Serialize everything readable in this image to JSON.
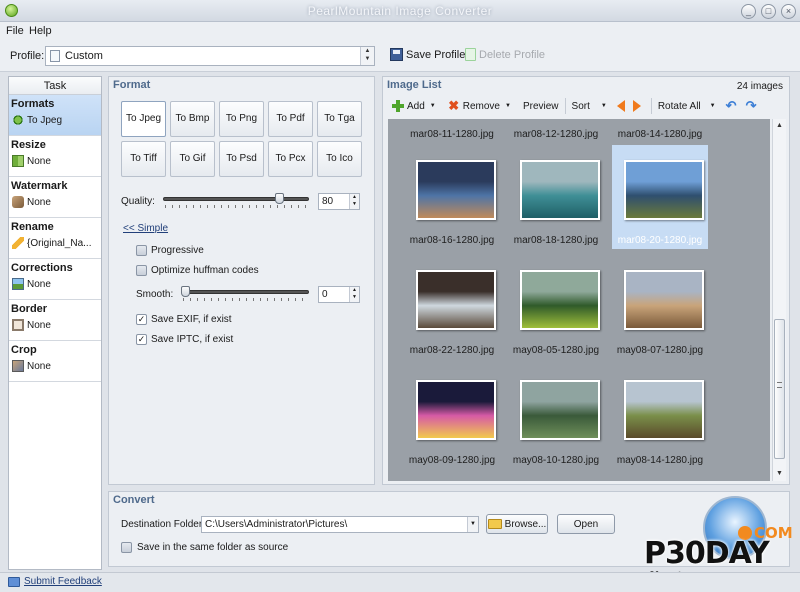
{
  "window": {
    "title": "PearlMountain Image Converter",
    "controls": [
      "_",
      "□",
      "×"
    ]
  },
  "menu": {
    "items": [
      "File",
      "Help"
    ]
  },
  "profile": {
    "label": "Profile:",
    "value": "Custom",
    "save_label": "Save Profile",
    "delete_label": "Delete Profile"
  },
  "task": {
    "header": "Task",
    "sections": [
      {
        "title": "Formats",
        "value": "To Jpeg",
        "icon": "convert-icon"
      },
      {
        "title": "Resize",
        "value": "None",
        "icon": "resize-icon"
      },
      {
        "title": "Watermark",
        "value": "None",
        "icon": "watermark-icon"
      },
      {
        "title": "Rename",
        "value": "{Original_Na...",
        "icon": "pencil-icon"
      },
      {
        "title": "Corrections",
        "value": "None",
        "icon": "corrections-icon"
      },
      {
        "title": "Border",
        "value": "None",
        "icon": "border-icon"
      },
      {
        "title": "Crop",
        "value": "None",
        "icon": "crop-icon"
      }
    ]
  },
  "format": {
    "title": "Format",
    "buttons": [
      "To Jpeg",
      "To Bmp",
      "To Png",
      "To Pdf",
      "To Tga",
      "To Tiff",
      "To Gif",
      "To Psd",
      "To Pcx",
      "To Ico"
    ],
    "quality_label": "Quality:",
    "quality_value": "80",
    "quality_level": 0.8,
    "simple_link": "<< Simple",
    "progressive_label": "Progressive",
    "huffman_label": "Optimize huffman codes",
    "smooth_label": "Smooth:",
    "smooth_value": "0",
    "smooth_level": 0,
    "exif_label": "Save EXIF, if exist",
    "iptc_label": "Save IPTC, if exist"
  },
  "imagelist": {
    "title": "Image List",
    "count": "24 images",
    "toolbar": {
      "add": "Add",
      "remove": "Remove",
      "preview": "Preview",
      "sort": "Sort",
      "rotate_all": "Rotate All"
    },
    "top_row_names": [
      "mar08-11-1280.jpg",
      "mar08-12-1280.jpg",
      "mar08-14-1280.jpg"
    ],
    "thumbnails": [
      {
        "name": "mar08-16-1280.jpg",
        "colors": [
          "#2b3b5c",
          "#4e74a6",
          "#c08a5a"
        ]
      },
      {
        "name": "mar08-18-1280.jpg",
        "colors": [
          "#9fb7bd",
          "#3f8f96",
          "#1f5f66"
        ]
      },
      {
        "name": "mar08-20-1280.jpg",
        "colors": [
          "#6f9fd6",
          "#2f4f6f",
          "#6b7a3a"
        ]
      },
      {
        "name": "mar08-22-1280.jpg",
        "colors": [
          "#3a2f2a",
          "#cfd8df",
          "#5a4a3a"
        ]
      },
      {
        "name": "may08-05-1280.jpg",
        "colors": [
          "#8fa99a",
          "#2f5a2a",
          "#9fbf3a"
        ]
      },
      {
        "name": "may08-07-1280.jpg",
        "colors": [
          "#a9b4c4",
          "#c9a47a",
          "#7a5a3a"
        ]
      },
      {
        "name": "may08-09-1280.jpg",
        "colors": [
          "#1a1a3a",
          "#d65aa6",
          "#f2c94c"
        ]
      },
      {
        "name": "may08-10-1280.jpg",
        "colors": [
          "#8fa4a0",
          "#3a5a3a",
          "#6f8f5a"
        ]
      },
      {
        "name": "may08-14-1280.jpg",
        "colors": [
          "#b7c4d0",
          "#7a8f4a",
          "#5a4a2a"
        ]
      }
    ]
  },
  "convert": {
    "title": "Convert",
    "dest_label": "Destination Folder:",
    "dest_value": "C:\\Users\\Administrator\\Pictures\\",
    "browse_label": "Browse...",
    "open_label": "Open",
    "same_folder_label": "Save in the same folder as source"
  },
  "watermark": {
    "com": "COM",
    "main": "P30DAY",
    "sub": "پی سی دی"
  },
  "status": {
    "feedback": "Submit Feedback"
  }
}
